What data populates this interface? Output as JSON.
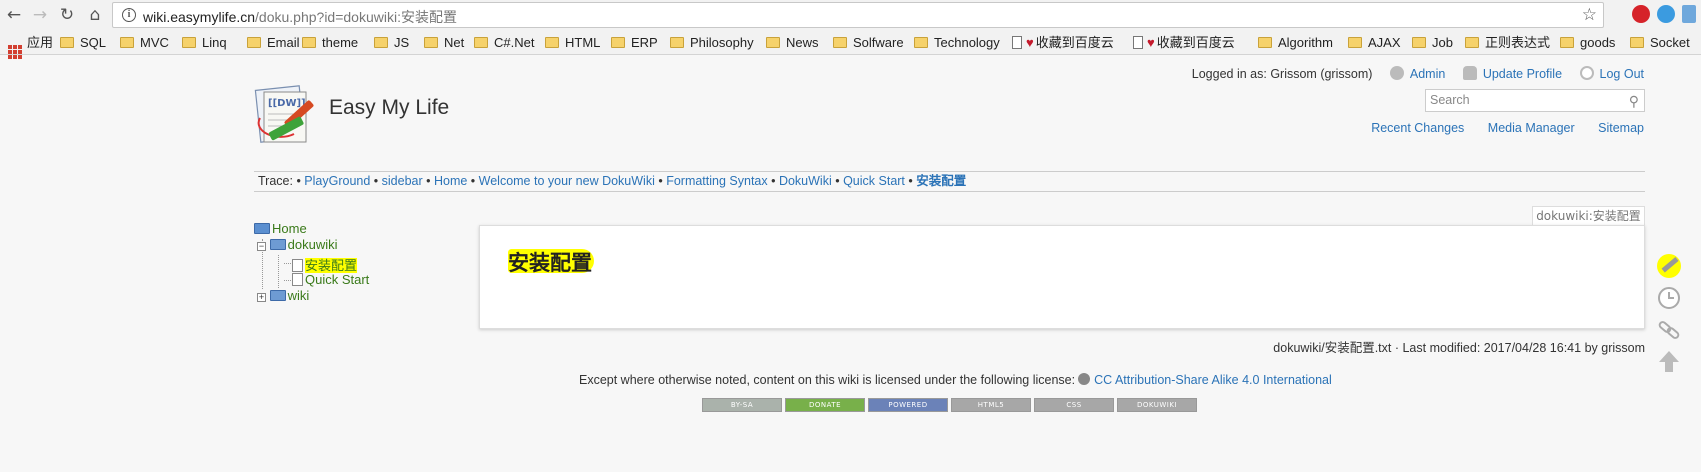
{
  "browser": {
    "url_host": "wiki.easymylife.cn",
    "url_rest": "/doku.php?id=dokuwiki:安装配置",
    "bookmarks": [
      {
        "label": "应用",
        "icon": "apps-icon"
      },
      {
        "label": "SQL",
        "icon": "folder-icon"
      },
      {
        "label": "MVC",
        "icon": "folder-icon"
      },
      {
        "label": "Linq",
        "icon": "folder-icon"
      },
      {
        "label": "Email",
        "icon": "folder-icon"
      },
      {
        "label": "theme",
        "icon": "folder-icon"
      },
      {
        "label": "JS",
        "icon": "folder-icon"
      },
      {
        "label": "Net",
        "icon": "folder-icon"
      },
      {
        "label": "C#.Net",
        "icon": "folder-icon"
      },
      {
        "label": "HTML",
        "icon": "folder-icon"
      },
      {
        "label": "ERP",
        "icon": "folder-icon"
      },
      {
        "label": "Philosophy",
        "icon": "folder-icon"
      },
      {
        "label": "News",
        "icon": "folder-icon"
      },
      {
        "label": "Solfware",
        "icon": "folder-icon"
      },
      {
        "label": "Technology",
        "icon": "folder-icon"
      },
      {
        "label": "收藏到百度云",
        "icon": "page-heart-icon"
      },
      {
        "label": "收藏到百度云",
        "icon": "page-heart-icon"
      },
      {
        "label": "Algorithm",
        "icon": "folder-icon"
      },
      {
        "label": "AJAX",
        "icon": "folder-icon"
      },
      {
        "label": "Job",
        "icon": "folder-icon"
      },
      {
        "label": "正则表达式",
        "icon": "folder-icon"
      },
      {
        "label": "goods",
        "icon": "folder-icon"
      },
      {
        "label": "Socket",
        "icon": "folder-icon"
      }
    ]
  },
  "header": {
    "site_title": "Easy My Life",
    "logged_in": "Logged in as: Grissom (grissom)",
    "admin": "Admin",
    "update_profile": "Update Profile",
    "logout": "Log Out",
    "search_placeholder": "Search",
    "recent_changes": "Recent Changes",
    "media_manager": "Media Manager",
    "sitemap": "Sitemap"
  },
  "trace": {
    "label": "Trace:",
    "items": [
      "PlayGround",
      "sidebar",
      "Home",
      "Welcome to your new DokuWiki",
      "Formatting Syntax",
      "DokuWiki",
      "Quick Start",
      "安装配置"
    ]
  },
  "sidebar": {
    "home": "Home",
    "dokuwiki": "dokuwiki",
    "page_install": "安装配置",
    "page_quickstart": "Quick Start",
    "wiki": "wiki"
  },
  "content": {
    "page_id": "dokuwiki:安装配置",
    "heading": "安装配置"
  },
  "footer": {
    "docinfo": "dokuwiki/安装配置.txt · Last modified: 2017/04/28 16:41 by grissom",
    "license_text": "Except where otherwise noted, content on this wiki is licensed under the following license:",
    "license_link": "CC Attribution-Share Alike 4.0 International",
    "badges": [
      "BY-SA",
      "DONATE",
      "POWERED",
      "HTML5",
      "CSS",
      "DOKUWIKI"
    ]
  },
  "colors": {
    "link": "#2b73b7",
    "tree_link": "#3a7a1a",
    "highlight": "#ffff00"
  }
}
